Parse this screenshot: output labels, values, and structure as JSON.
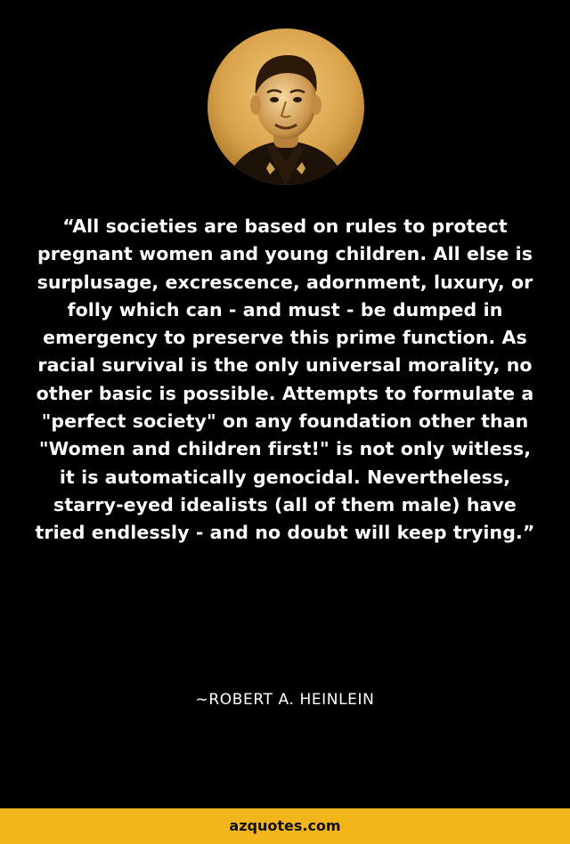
{
  "portrait": {
    "icon": "author-portrait-photo",
    "tone_color": "#d9a24a"
  },
  "quote": {
    "text": "“All societies are based on rules to protect pregnant women and young children. All else is surplusage, excrescence, adornment, luxury, or folly which can - and must - be dumped in emergency to preserve this prime function. As racial survival is the only universal morality, no other basic is possible. Attempts to formulate a \"perfect society\" on any foundation other than \"Women and children first!\" is not only witless, it is automatically genocidal. Nevertheless, starry-eyed idealists (all of them male) have tried endlessly - and no doubt will keep trying.”"
  },
  "author": {
    "text": "~ROBERT A. HEINLEIN"
  },
  "footer": {
    "site": "azquotes.com",
    "background": "#f3b51c"
  }
}
